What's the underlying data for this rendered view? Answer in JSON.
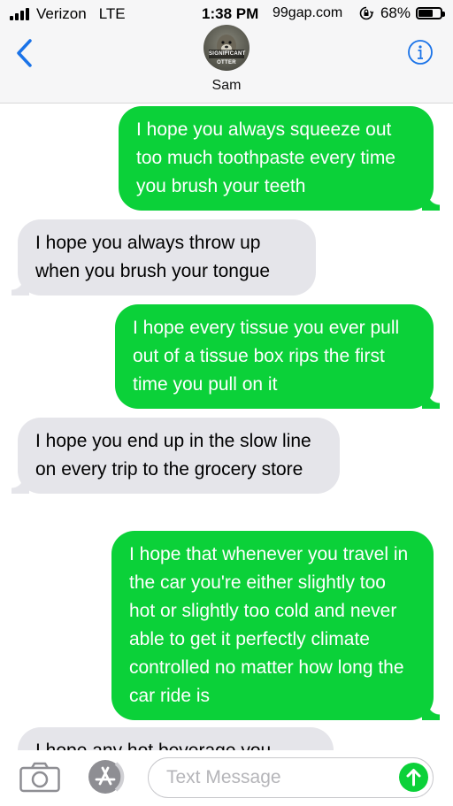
{
  "status": {
    "carrier": "Verizon",
    "network": "LTE",
    "time": "1:38 PM",
    "site": "99gap.com",
    "battery": "68%",
    "battery_level": 0.68
  },
  "header": {
    "contact_name": "Sam",
    "avatar_text": "SIGNIFICANT OTTER"
  },
  "messages": [
    {
      "from": "me",
      "text": "I hope you always squeeze out too much toothpaste every time you brush your teeth"
    },
    {
      "from": "them",
      "text": "I hope you always throw up when you brush your tongue"
    },
    {
      "from": "me",
      "text": "I hope every tissue you ever pull out of a tissue box rips the first time you pull on it"
    },
    {
      "from": "them",
      "text": "I hope you end up in the slow line on every trip to the grocery store"
    },
    {
      "from": "me",
      "text": "I hope that whenever you travel in the car you're either slightly too hot or slightly too cold and never able to get it perfectly climate controlled no matter how long the car ride is"
    },
    {
      "from": "them",
      "text": "I hope any hot beverage you"
    }
  ],
  "input": {
    "placeholder": "Text Message",
    "value": ""
  },
  "colors": {
    "sent_bubble": "#0bd139",
    "received_bubble": "#e5e5ea",
    "accent": "#1a73e8"
  },
  "icons": [
    "signal-bars-icon",
    "rotation-lock-icon",
    "battery-icon",
    "back-chevron-icon",
    "info-icon",
    "camera-icon",
    "app-store-icon",
    "send-arrow-icon"
  ]
}
